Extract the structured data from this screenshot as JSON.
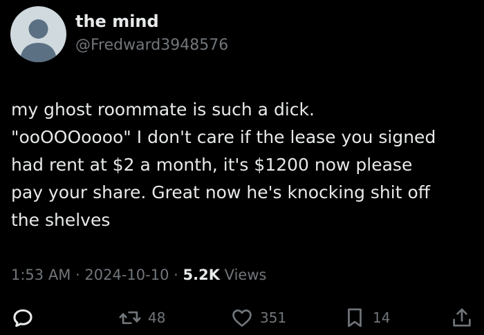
{
  "author": {
    "display_name": "the mind",
    "handle": "@Fredward3948576"
  },
  "tweet": {
    "lines": [
      "my ghost roommate is such a dick.",
      "\"ooOOOoooo\" I don't care if the lease you signed",
      "had rent at $2 a month, it's $1200 now please",
      "pay your share. Great now he's knocking shit off",
      "the shelves"
    ]
  },
  "meta": {
    "time": "1:53 AM",
    "separator": "·",
    "date": "2024-10-10",
    "views_count": "5.2K",
    "views_label": "Views"
  },
  "actions": {
    "reply_icon": "reply-icon",
    "retweet_icon": "retweet-icon",
    "retweet_count": "48",
    "like_icon": "heart-icon",
    "like_count": "351",
    "bookmark_icon": "bookmark-icon",
    "bookmark_count": "14",
    "share_icon": "share-icon"
  },
  "colors": {
    "background": "#000000",
    "primary_text": "#e7e9ea",
    "secondary_text": "#71767b",
    "avatar_bg": "#cfd9de",
    "avatar_fg": "#5b7083"
  }
}
